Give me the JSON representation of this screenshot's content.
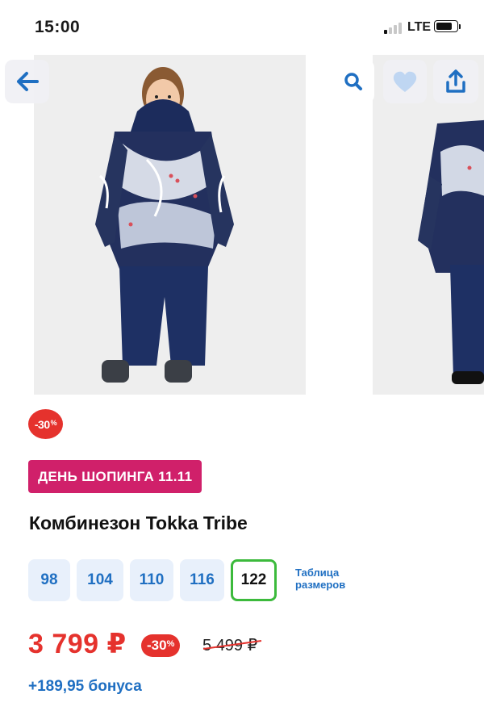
{
  "status_bar": {
    "time": "15:00",
    "network": "LTE"
  },
  "gallery": {
    "images": [
      "product-photo-front",
      "product-photo-side"
    ]
  },
  "toolbar": {
    "back_icon": "arrow-left-icon",
    "search_icon": "search-icon",
    "favorite_icon": "heart-icon",
    "share_icon": "share-icon"
  },
  "discount_badge": {
    "value": "-30",
    "unit": "%"
  },
  "promo_label": "ДЕНЬ ШОПИНГА 11.11",
  "product_title": "Комбинезон Tokka Tribe",
  "sizes": {
    "options": [
      "98",
      "104",
      "110",
      "116",
      "122"
    ],
    "selected": "122",
    "chart_link": "Таблица размеров"
  },
  "price": {
    "current": "3 799 ₽",
    "discount": "-30",
    "discount_unit": "%",
    "old": "5 499 ₽"
  },
  "bonus": "+189,95 бонуса",
  "colors": {
    "accent_red": "#e5322d",
    "promo_pink": "#d0206a",
    "link_blue": "#1f6fc2",
    "selected_green": "#3cba3c"
  }
}
